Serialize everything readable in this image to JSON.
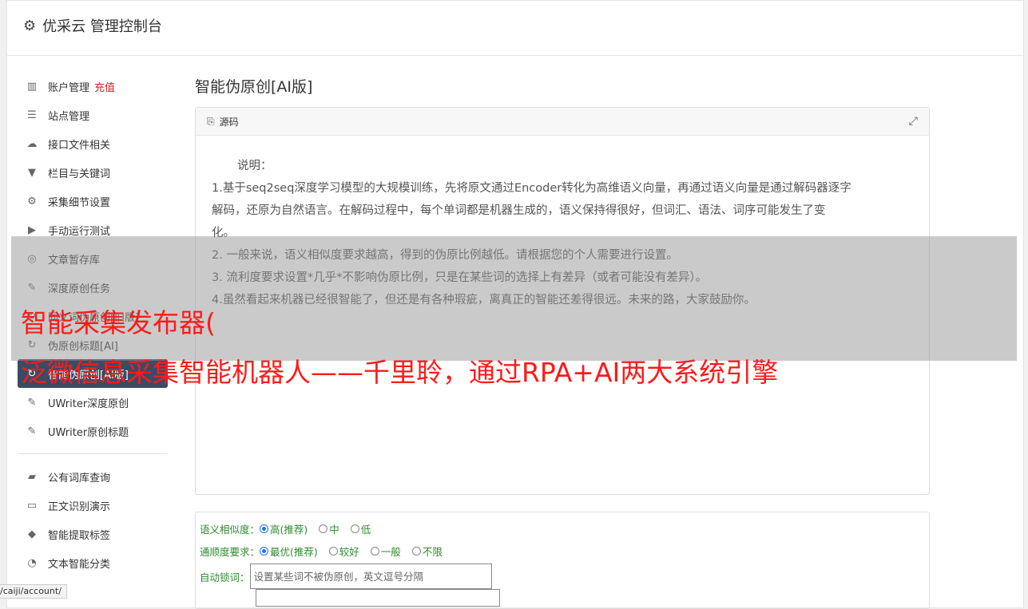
{
  "header": {
    "title": "优采云 管理控制台"
  },
  "sidebar": {
    "items": [
      {
        "label": "账户管理",
        "accent": "充值",
        "icon": "bar-chart-icon"
      },
      {
        "label": "站点管理",
        "icon": "server-icon"
      },
      {
        "label": "接口文件相关",
        "icon": "cloud-upload-icon"
      },
      {
        "label": "栏目与关键词",
        "icon": "filter-icon"
      },
      {
        "label": "采集细节设置",
        "icon": "gears-icon"
      },
      {
        "label": "手动运行测试",
        "icon": "play-circle-icon"
      },
      {
        "label": "文章暂存库",
        "icon": "database-icon"
      },
      {
        "label": "深度原创任务",
        "icon": "edit-icon"
      },
      {
        "label": "同义词伪原创[旧版]",
        "icon": "refresh-icon"
      },
      {
        "label": "伪原创标题[AI]",
        "icon": "refresh-icon"
      },
      {
        "label": "智能伪原创[AI版]",
        "icon": "refresh-icon",
        "active": true
      },
      {
        "label": "UWriter深度原创",
        "icon": "edit-icon"
      },
      {
        "label": "UWriter原创标题",
        "icon": "edit-icon"
      },
      {
        "label": "公有词库查询",
        "icon": "book-icon"
      },
      {
        "label": "正文识别演示",
        "icon": "desktop-icon"
      },
      {
        "label": "智能提取标签",
        "icon": "tag-icon"
      },
      {
        "label": "文本智能分类",
        "icon": "pie-chart-icon"
      }
    ]
  },
  "main": {
    "page_title": "智能伪原创[AI版]",
    "panel": {
      "title": "源码",
      "note_title": "说明：",
      "lines": [
        "1.基于seq2seq深度学习模型的大规模训练，先将原文通过Encoder转化为高维语义向量，再通过语义向量是通过解码器逐字",
        "解码，还原为自然语言。在解码过程中，每个单词都是机器生成的，语义保持得很好，但词汇、语法、词序可能发生了变",
        "化。",
        "2. 一般来说，语义相似度要求越高，得到的伪原比例越低。请根据您的个人需要进行设置。",
        "3. 流利度要求设置*几乎*不影响伪原比例，只是在某些词的选择上有差异（或者可能没有差异）。",
        "4.虽然看起来机器已经很智能了，但还是有各种瑕疵，离真正的智能还差得很远。未来的路，大家鼓励你。"
      ]
    },
    "form": {
      "similarity": {
        "label": "语义相似度：",
        "options": [
          "高(推荐)",
          "中",
          "低"
        ],
        "selected": 0
      },
      "fluency": {
        "label": "通顺度要求：",
        "options": [
          "最优(推荐)",
          "较好",
          "一般",
          "不限"
        ],
        "selected": 0
      },
      "lock": {
        "label": "自动锁词：",
        "placeholder": "设置某些词不被伪原创，英文逗号分隔"
      }
    }
  },
  "overlay": {
    "line1": "智能采集发布器(",
    "line2": "泛微信息采集智能机器人——千里聆，通过RPA+AI两大系统引擎"
  },
  "statusbar": {
    "url": "/caiji/account/"
  }
}
